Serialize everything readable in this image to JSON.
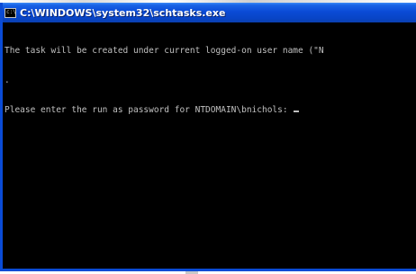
{
  "window": {
    "title": "C:\\WINDOWS\\system32\\schtasks.exe",
    "icon": "console-icon",
    "icon_glyph": "c:\\"
  },
  "console": {
    "lines": [
      "The task will be created under current logged-on user name (\"N",
      ".",
      "Please enter the run as password for NTDOMAIN\\bnichols: "
    ]
  },
  "colors": {
    "title_bar": "#0a4bd6",
    "console_bg": "#000000",
    "console_text": "#c0c0c0"
  }
}
